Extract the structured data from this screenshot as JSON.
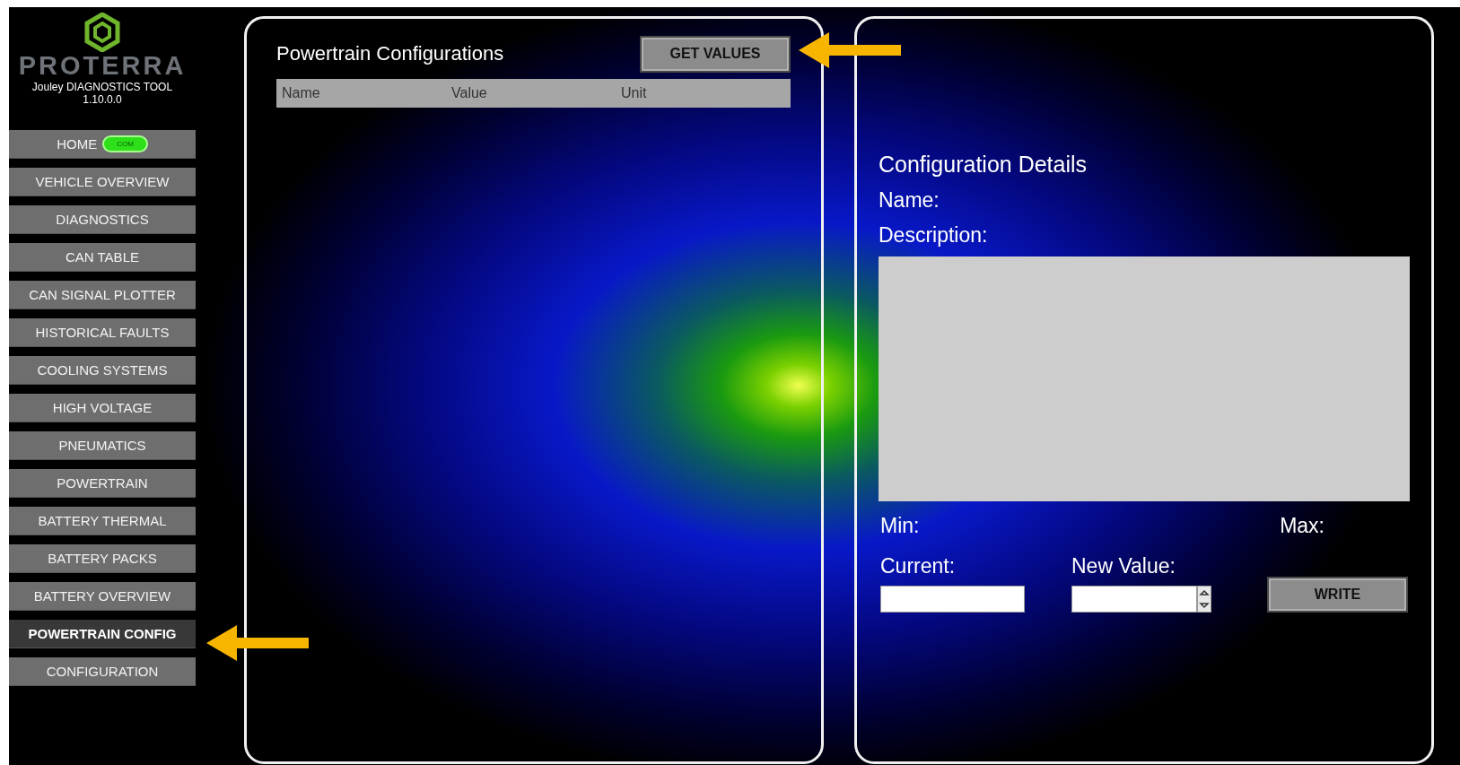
{
  "logo": {
    "brand": "PROTERRA",
    "subtitle": "Jouley DIAGNOSTICS TOOL",
    "version": "1.10.0.0"
  },
  "sidebar": {
    "items": [
      {
        "label": "HOME",
        "selected": false,
        "badge": "COM"
      },
      {
        "label": "VEHICLE OVERVIEW",
        "selected": false
      },
      {
        "label": "DIAGNOSTICS",
        "selected": false
      },
      {
        "label": "CAN TABLE",
        "selected": false
      },
      {
        "label": "CAN SIGNAL PLOTTER",
        "selected": false
      },
      {
        "label": "HISTORICAL FAULTS",
        "selected": false
      },
      {
        "label": "COOLING SYSTEMS",
        "selected": false
      },
      {
        "label": "HIGH VOLTAGE",
        "selected": false
      },
      {
        "label": "PNEUMATICS",
        "selected": false
      },
      {
        "label": "POWERTRAIN",
        "selected": false
      },
      {
        "label": "BATTERY THERMAL",
        "selected": false
      },
      {
        "label": "BATTERY PACKS",
        "selected": false
      },
      {
        "label": "BATTERY OVERVIEW",
        "selected": false
      },
      {
        "label": "POWERTRAIN CONFIG",
        "selected": true
      },
      {
        "label": "CONFIGURATION",
        "selected": false
      }
    ]
  },
  "config_list": {
    "title": "Powertrain Configurations",
    "button": "GET VALUES",
    "columns": [
      "Name",
      "Value",
      "Unit"
    ]
  },
  "details": {
    "title": "Configuration Details",
    "name_label": "Name:",
    "description_label": "Description:",
    "min_label": "Min:",
    "max_label": "Max:",
    "current_label": "Current:",
    "new_value_label": "New Value:",
    "write_button": "WRITE"
  }
}
